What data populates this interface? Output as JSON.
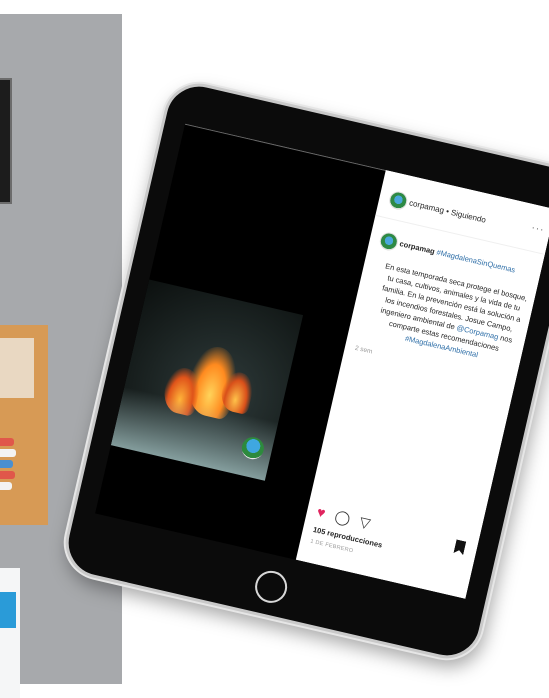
{
  "post": {
    "account": "corpamag",
    "follow_state": "• Siguiendo",
    "more": "···",
    "hashtag_title": "#MagdalenaSinQuemas",
    "caption_part1": "En esta temporada seca protege el bosque, tu casa, cultivos, animales y la vida de tu familia. En la prevención está la solución a los incendios forestales. Josue Campo, ingeniero ambiental de ",
    "mention": "@Corpamag",
    "caption_part2": " nos comparte estas recomendaciones ",
    "hashtag_end": "#MagdalenaAmbiental",
    "time_ago": "2 sem",
    "views": "105 reproducciones",
    "date": "1 DE FEBRERO"
  },
  "icons": {
    "heart": "♥",
    "comment": "◯",
    "share": "▽"
  },
  "colors": {
    "heart": "#e0245e",
    "link": "#2f6fa8",
    "bg_panel": "#a7a9ac"
  }
}
